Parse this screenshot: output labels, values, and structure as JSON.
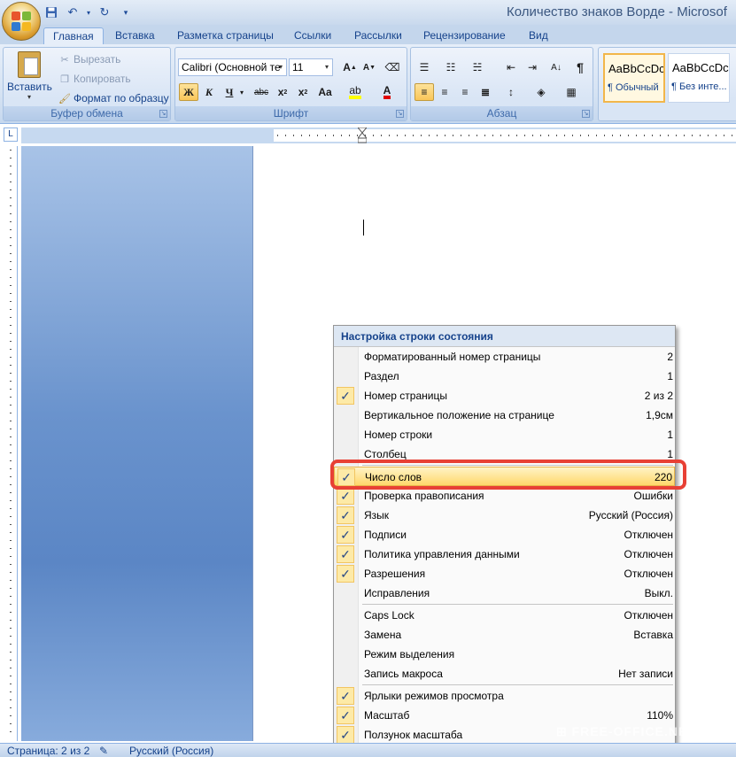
{
  "window": {
    "title": "Количество знаков Ворде - Microsof"
  },
  "quick_access": {
    "icons": [
      "save-icon",
      "undo-icon",
      "redo-icon",
      "customize-icon"
    ]
  },
  "tabs": [
    "Главная",
    "Вставка",
    "Разметка страницы",
    "Ссылки",
    "Рассылки",
    "Рецензирование",
    "Вид"
  ],
  "ribbon": {
    "clipboard": {
      "label": "Буфер обмена",
      "paste": "Вставить",
      "cut": "Вырезать",
      "copy": "Копировать",
      "format_painter": "Формат по образцу"
    },
    "font": {
      "label": "Шрифт",
      "font_name": "Calibri (Основной те",
      "font_size": "11"
    },
    "paragraph": {
      "label": "Абзац"
    },
    "styles": {
      "normal_sample": "AaBbCcDc",
      "normal_name": "¶ Обычный",
      "nospacing_sample": "AaBbCcDc",
      "nospacing_name": "¶ Без инте..."
    }
  },
  "context_menu": {
    "title": "Настройка строки состояния",
    "items": [
      {
        "label": "Форматированный номер страницы",
        "value": "2",
        "checked": false
      },
      {
        "label": "Раздел",
        "value": "1",
        "checked": false
      },
      {
        "label": "Номер страницы",
        "value": "2 из 2",
        "checked": true
      },
      {
        "label": "Вертикальное положение на странице",
        "value": "1,9см",
        "checked": false
      },
      {
        "label": "Номер строки",
        "value": "1",
        "checked": false
      },
      {
        "label": "Столбец",
        "value": "1",
        "checked": false
      },
      {
        "label": "Число слов",
        "value": "220",
        "checked": true
      },
      {
        "label": "Проверка правописания",
        "value": "Ошибки",
        "checked": true
      },
      {
        "label": "Язык",
        "value": "Русский (Россия)",
        "checked": true
      },
      {
        "label": "Подписи",
        "value": "Отключен",
        "checked": true
      },
      {
        "label": "Политика управления данными",
        "value": "Отключен",
        "checked": true
      },
      {
        "label": "Разрешения",
        "value": "Отключен",
        "checked": true
      },
      {
        "label": "Исправления",
        "value": "Выкл.",
        "checked": false
      },
      {
        "label": "Caps Lock",
        "value": "Отключен",
        "checked": false
      },
      {
        "label": "Замена",
        "value": "Вставка",
        "checked": false
      },
      {
        "label": "Режим выделения",
        "value": "",
        "checked": false
      },
      {
        "label": "Запись макроса",
        "value": "Нет записи",
        "checked": false
      },
      {
        "label": "Ярлыки режимов просмотра",
        "value": "",
        "checked": true
      },
      {
        "label": "Масштаб",
        "value": "110%",
        "checked": true
      },
      {
        "label": "Ползунок масштаба",
        "value": "",
        "checked": true
      }
    ],
    "highlighted_index": 6,
    "separators_after": [
      5,
      12,
      16
    ]
  },
  "statusbar": {
    "page": "Страница: 2 из 2",
    "language": "Русский (Россия)"
  },
  "watermark": "FREE-OFFICE.NET",
  "colors": {
    "highlight_border": "#e84035",
    "check_bg": "#fdeaa7"
  }
}
